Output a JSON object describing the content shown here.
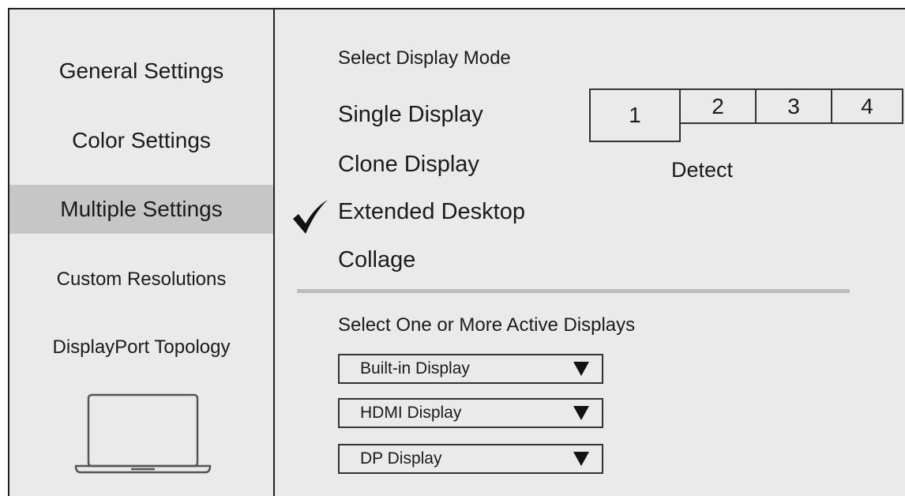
{
  "sidebar": {
    "items": [
      {
        "label": "General Settings",
        "active": false
      },
      {
        "label": "Color Settings",
        "active": false
      },
      {
        "label": "Multiple Settings",
        "active": true
      },
      {
        "label": "Custom Resolutions",
        "active": false
      },
      {
        "label": "DisplayPort Topology",
        "active": false
      }
    ],
    "illustration_icon": "laptop-icon"
  },
  "display_mode": {
    "heading": "Select Display Mode",
    "modes": [
      {
        "label": "Single Display",
        "selected": false
      },
      {
        "label": "Clone Display",
        "selected": false
      },
      {
        "label": "Extended Desktop",
        "selected": true
      },
      {
        "label": "Collage",
        "selected": false
      }
    ],
    "check_icon": "checkmark-icon"
  },
  "monitors": {
    "numbers": [
      "1",
      "2",
      "3",
      "4"
    ],
    "detect_label": "Detect"
  },
  "active_displays": {
    "heading": "Select One or More Active Displays",
    "dropdowns": [
      {
        "label": "Built-in Display"
      },
      {
        "label": "HDMI Display"
      },
      {
        "label": "DP Display"
      }
    ],
    "arrow_icon": "triangle-down-icon"
  },
  "colors": {
    "panel_background": "#ebeaea",
    "active_item_background": "#c6c6c6",
    "divider": "#bdbdbd",
    "border": "#222222"
  }
}
